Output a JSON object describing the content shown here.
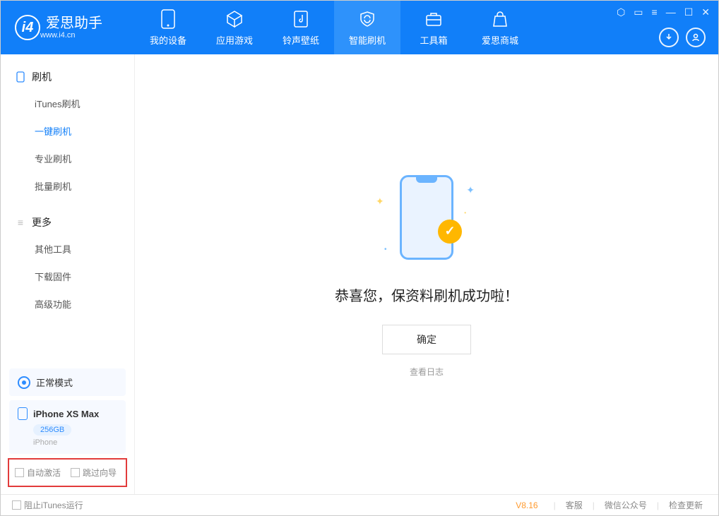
{
  "app": {
    "name": "爱思助手",
    "url": "www.i4.cn"
  },
  "tabs": [
    {
      "label": "我的设备"
    },
    {
      "label": "应用游戏"
    },
    {
      "label": "铃声壁纸"
    },
    {
      "label": "智能刷机"
    },
    {
      "label": "工具箱"
    },
    {
      "label": "爱思商城"
    }
  ],
  "sidebar": {
    "section1": {
      "title": "刷机",
      "items": [
        "iTunes刷机",
        "一键刷机",
        "专业刷机",
        "批量刷机"
      ]
    },
    "section2": {
      "title": "更多",
      "items": [
        "其他工具",
        "下载固件",
        "高级功能"
      ]
    },
    "mode": "正常模式",
    "device": {
      "name": "iPhone XS Max",
      "capacity": "256GB",
      "type": "iPhone"
    },
    "options": {
      "auto_activate": "自动激活",
      "skip_guide": "跳过向导"
    }
  },
  "main": {
    "success": "恭喜您，保资料刷机成功啦！",
    "ok": "确定",
    "view_log": "查看日志"
  },
  "statusbar": {
    "block_itunes": "阻止iTunes运行",
    "version": "V8.16",
    "links": [
      "客服",
      "微信公众号",
      "检查更新"
    ]
  }
}
